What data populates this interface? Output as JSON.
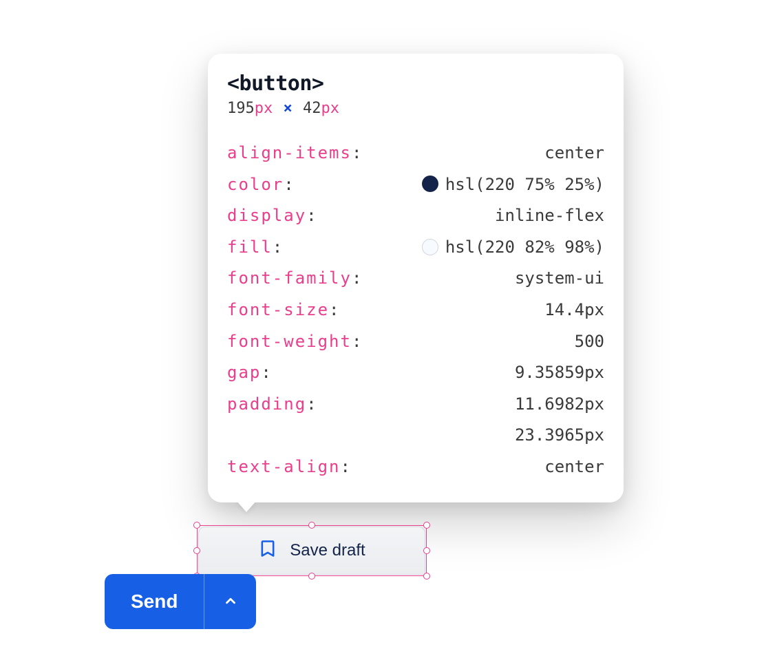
{
  "tooltip": {
    "tag": "<button>",
    "dims": {
      "w": "195",
      "wu": "px",
      "sep": "×",
      "h": "42",
      "hu": "px"
    },
    "props": [
      {
        "key": "align-items",
        "value": "center"
      },
      {
        "key": "color",
        "value": "hsl(220 75% 25%)",
        "swatch": "dark"
      },
      {
        "key": "display",
        "value": "inline-flex"
      },
      {
        "key": "fill",
        "value": "hsl(220 82% 98%)",
        "swatch": "light"
      },
      {
        "key": "font-family",
        "value": "system-ui"
      },
      {
        "key": "font-size",
        "value": "14.4px"
      },
      {
        "key": "font-weight",
        "value": "500"
      },
      {
        "key": "gap",
        "value": "9.35859px"
      },
      {
        "key": "padding",
        "value": "11.6982px\n23.3965px"
      },
      {
        "key": "text-align",
        "value": "center"
      }
    ]
  },
  "saveDraft": {
    "label": "Save draft"
  },
  "send": {
    "label": "Send"
  }
}
